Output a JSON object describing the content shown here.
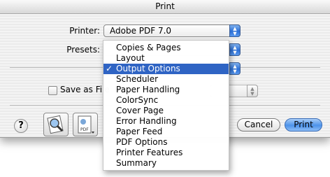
{
  "window": {
    "title": "Print"
  },
  "printer": {
    "label": "Printer:",
    "value": "Adobe PDF 7.0"
  },
  "presets": {
    "label": "Presets:"
  },
  "save_as_file": {
    "label": "Save as File"
  },
  "menu": {
    "items": [
      {
        "label": "Copies & Pages",
        "selected": false
      },
      {
        "label": "Layout",
        "selected": false
      },
      {
        "label": "Output Options",
        "selected": true
      },
      {
        "label": "Scheduler",
        "selected": false
      },
      {
        "label": "Paper Handling",
        "selected": false
      },
      {
        "label": "ColorSync",
        "selected": false
      },
      {
        "label": "Cover Page",
        "selected": false
      },
      {
        "label": "Error Handling",
        "selected": false
      },
      {
        "label": "Paper Feed",
        "selected": false
      },
      {
        "label": "PDF Options",
        "selected": false
      },
      {
        "label": "Printer Features",
        "selected": false
      },
      {
        "label": "Summary",
        "selected": false
      }
    ],
    "check_glyph": "✓"
  },
  "buttons": {
    "help": "?",
    "cancel": "Cancel",
    "print": "Print",
    "pdf_icon_text": "PDF"
  },
  "colors": {
    "selection": "#2f64c4",
    "accent": "#4d93ea"
  }
}
